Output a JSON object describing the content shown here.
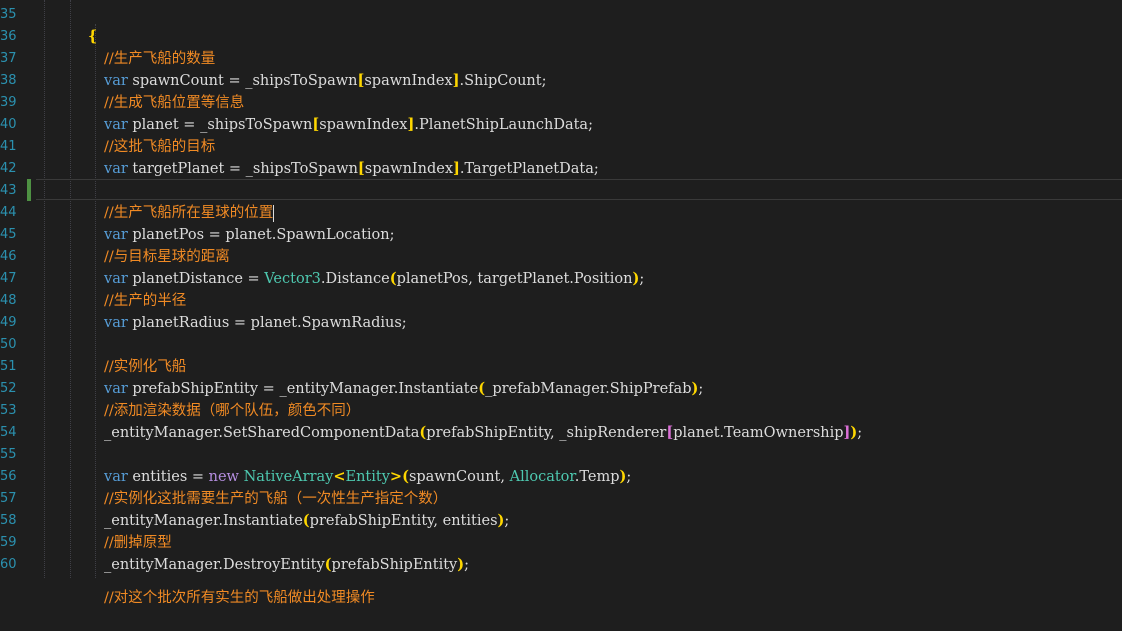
{
  "line_numbers": [
    "35",
    "36",
    "37",
    "38",
    "39",
    "40",
    "41",
    "42",
    "43",
    "44",
    "45",
    "46",
    "47",
    "48",
    "49",
    "50",
    "51",
    "52",
    "53",
    "54",
    "55",
    "56",
    "57",
    "58",
    "59",
    "60"
  ],
  "code": {
    "l36_comment": "//生产飞船的数量",
    "l37": {
      "kw": "var",
      "name": " spawnCount = _shipsToSpawn",
      "o": "[",
      "mid": "spawnIndex",
      "c": "]",
      "tail": ".ShipCount;"
    },
    "l38_comment": "//生成飞船位置等信息",
    "l39": {
      "kw": "var",
      "name": " planet = _shipsToSpawn",
      "o": "[",
      "mid": "spawnIndex",
      "c": "]",
      "tail": ".PlanetShipLaunchData;"
    },
    "l40_comment": "//这批飞船的目标",
    "l41": {
      "kw": "var",
      "name": " targetPlanet = _shipsToSpawn",
      "o": "[",
      "mid": "spawnIndex",
      "c": "]",
      "tail": ".TargetPlanetData;"
    },
    "l43_comment": "//生产飞船所在星球的位置",
    "l44": {
      "kw": "var",
      "rest": " planetPos = planet.SpawnLocation;"
    },
    "l45_comment": "//与目标星球的距离",
    "l46": {
      "kw": "var",
      "a": " planetDistance = ",
      "type": "Vector3",
      "b": ".Distance",
      "o": "(",
      "mid": "planetPos, targetPlanet.Position",
      "c": ")",
      "tail": ";"
    },
    "l47_comment": "//生产的半径",
    "l48": {
      "kw": "var",
      "rest": " planetRadius = planet.SpawnRadius;"
    },
    "l50_comment": "//实例化飞船",
    "l51": {
      "kw": "var",
      "a": " prefabShipEntity = _entityManager.Instantiate",
      "o": "(",
      "mid": "_prefabManager.ShipPrefab",
      "c": ")",
      "tail": ";"
    },
    "l52_comment": "//添加渲染数据（哪个队伍，颜色不同）",
    "l53": {
      "a": "_entityManager.SetSharedComponentData",
      "o": "(",
      "mid": "prefabShipEntity, _shipRenderer",
      "o2": "[",
      "mid2": "planet.TeamOwnership",
      "c2": "]",
      "c": ")",
      "tail": ";"
    },
    "l55": {
      "kw": "var",
      "a": " entities = ",
      "kw2": "new",
      "sp": " ",
      "type": "NativeArray",
      "lt": "<",
      "type2": "Entity",
      "gt": ">",
      "o": "(",
      "mid": "spawnCount, ",
      "type3": "Allocator",
      "mid2": ".Temp",
      "c": ")",
      "tail": ";"
    },
    "l56_comment": "//实例化这批需要生产的飞船（一次性生产指定个数）",
    "l57": {
      "a": "_entityManager.Instantiate",
      "o": "(",
      "mid": "prefabShipEntity, entities",
      "c": ")",
      "tail": ";"
    },
    "l58_comment": "//删掉原型",
    "l59": {
      "a": "_entityManager.DestroyEntity",
      "o": "(",
      "mid": "prefabShipEntity",
      "c": ")",
      "tail": ";"
    },
    "l60_comment": "//对这个批次所有实生的飞船做出处理操作"
  },
  "colors": {
    "background": "#1e1e1e",
    "comment": "#f08a24",
    "keyword": "#569cd6",
    "type": "#4ec9b0",
    "bracket": "#ffd700",
    "line_number": "#2b91af"
  }
}
